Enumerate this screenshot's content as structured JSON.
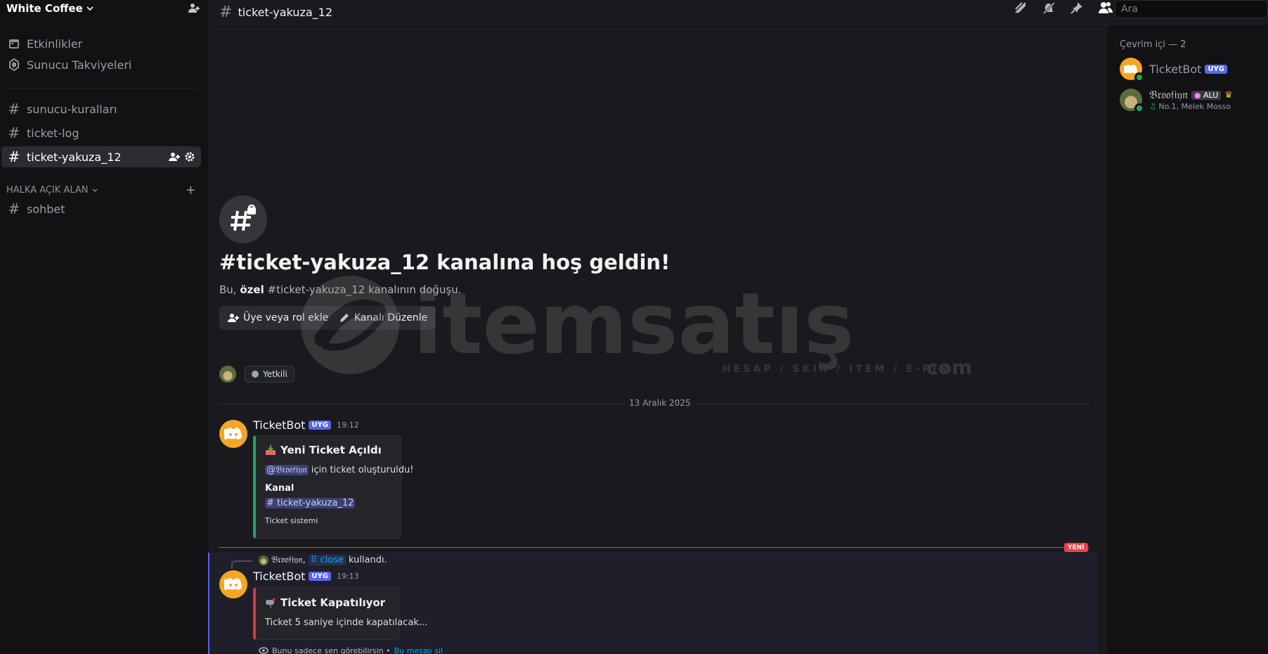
{
  "server": {
    "name": "White Coffee"
  },
  "sidebar": {
    "items": [
      {
        "label": "Etkinlikler",
        "icon": "calendar-icon"
      },
      {
        "label": "Sunucu Takviyeleri",
        "icon": "boost-icon"
      },
      {
        "label": "sunucu-kuralları",
        "icon": "hash-icon"
      },
      {
        "label": "ticket-log",
        "icon": "hash-icon"
      },
      {
        "label": "ticket-yakuza_12",
        "icon": "private-hash-icon"
      }
    ],
    "category": "HALKA AÇIK ALAN",
    "category_items": [
      {
        "label": "sohbet",
        "icon": "hash-icon"
      }
    ]
  },
  "topbar": {
    "channel": "ticket-yakuza_12",
    "search_placeholder": "Ara"
  },
  "welcome": {
    "title": "#ticket-yakuza_12 kanalına hoş geldin!",
    "sub_prefix": "Bu,",
    "sub_bold": "özel",
    "sub_suffix": "#ticket-yakuza_12 kanalının doğuşu.",
    "add_button": "Üye veya rol ekle",
    "edit_button": "Kanalı Düzenle",
    "role": "Yetkili"
  },
  "date_divider": "13 Aralık 2025",
  "messages": [
    {
      "author": "TicketBot",
      "badge": "UYG",
      "time": "19:12",
      "embed": {
        "title": "Yeni Ticket Açıldı",
        "mention": "@𝔅𝔯𝔬𝔬𝔣𝔦𝔶𝔫",
        "text": "için ticket oluşturuldu!",
        "field_name": "Kanal",
        "field_value": "# ticket-yakuza_12",
        "footer": "Ticket sistemi"
      }
    },
    {
      "author": "TicketBot",
      "badge": "UYG",
      "time": "19:13",
      "reply_user": "𝔅𝔯𝔬𝔬𝔣𝔦𝔶𝔫,",
      "reply_command": "close",
      "reply_suffix": "kullandı.",
      "embed": {
        "title": "Ticket Kapatılıyor",
        "text": "Ticket 5 saniye içinde kapatılacak..."
      },
      "ephemeral_note": "Bunu sadece sen görebilirsin •",
      "ephemeral_link": "Bu mesajı sil"
    }
  ],
  "new_label": "YENİ",
  "watermark": {
    "brand": "itemsatış",
    "tagline": "HESAP / SKIN / ITEM / E-PIN",
    "domain": "com"
  },
  "members": {
    "heading": "Çevrim içi — 2",
    "list": [
      {
        "name": "TicketBot",
        "badge": "UYG"
      },
      {
        "name": "𝔅𝔯𝔬𝔬𝔣𝔦𝔶𝔫",
        "badge": "ALU",
        "activity": "No.1, Melek Mosso"
      }
    ]
  },
  "colors": {
    "accent": "#5865f2",
    "online": "#23a559",
    "new": "#f23f43",
    "bot_avatar": "#f5a623"
  }
}
